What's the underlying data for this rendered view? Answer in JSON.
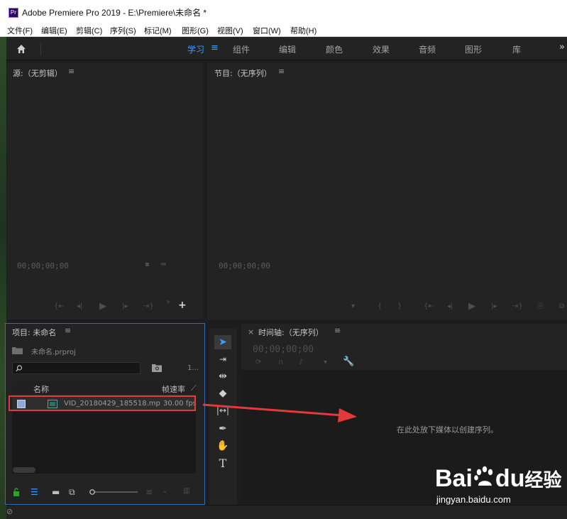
{
  "window": {
    "app_icon": "Pr",
    "title": "Adobe Premiere Pro 2019 - E:\\Premiere\\未命名 *"
  },
  "menu": [
    "文件(F)",
    "编辑(E)",
    "剪辑(C)",
    "序列(S)",
    "标记(M)",
    "图形(G)",
    "视图(V)",
    "窗口(W)",
    "帮助(H)"
  ],
  "workspaces": {
    "items": [
      "学习",
      "组件",
      "编辑",
      "颜色",
      "效果",
      "音频",
      "图形",
      "库"
    ],
    "active": "学习",
    "more": "»"
  },
  "source_panel": {
    "title": "源:（无剪辑）",
    "timecode": "00;00;00;00"
  },
  "program_panel": {
    "title": "节目:（无序列）",
    "timecode": "00;00;00;00"
  },
  "project_panel": {
    "title": "项目: 未命名",
    "file": "未命名.prproj",
    "count": "1...",
    "search_placeholder": "",
    "columns": {
      "name": "名称",
      "fps": "帧速率"
    },
    "rows": [
      {
        "name": "VID_20180429_185518.mp",
        "fps": "30.00 fps"
      }
    ]
  },
  "timeline_panel": {
    "close": "×",
    "title": "时间轴:（无序列）",
    "timecode": "00;00;00;00",
    "drop_hint": "在此处放下媒体以创建序列。"
  },
  "tools": [
    "selection-tool",
    "track-select-tool",
    "ripple-edit-tool",
    "razor-tool",
    "slip-tool",
    "pen-tool",
    "hand-tool",
    "type-tool"
  ],
  "watermark": {
    "brand": "Bai",
    "brand2": "du",
    "cn": "经验",
    "url": "jingyan.baidu.com"
  },
  "colors": {
    "accent": "#3d9dff",
    "highlight_box": "#e23a3a",
    "arrow": "#e23a3a"
  }
}
